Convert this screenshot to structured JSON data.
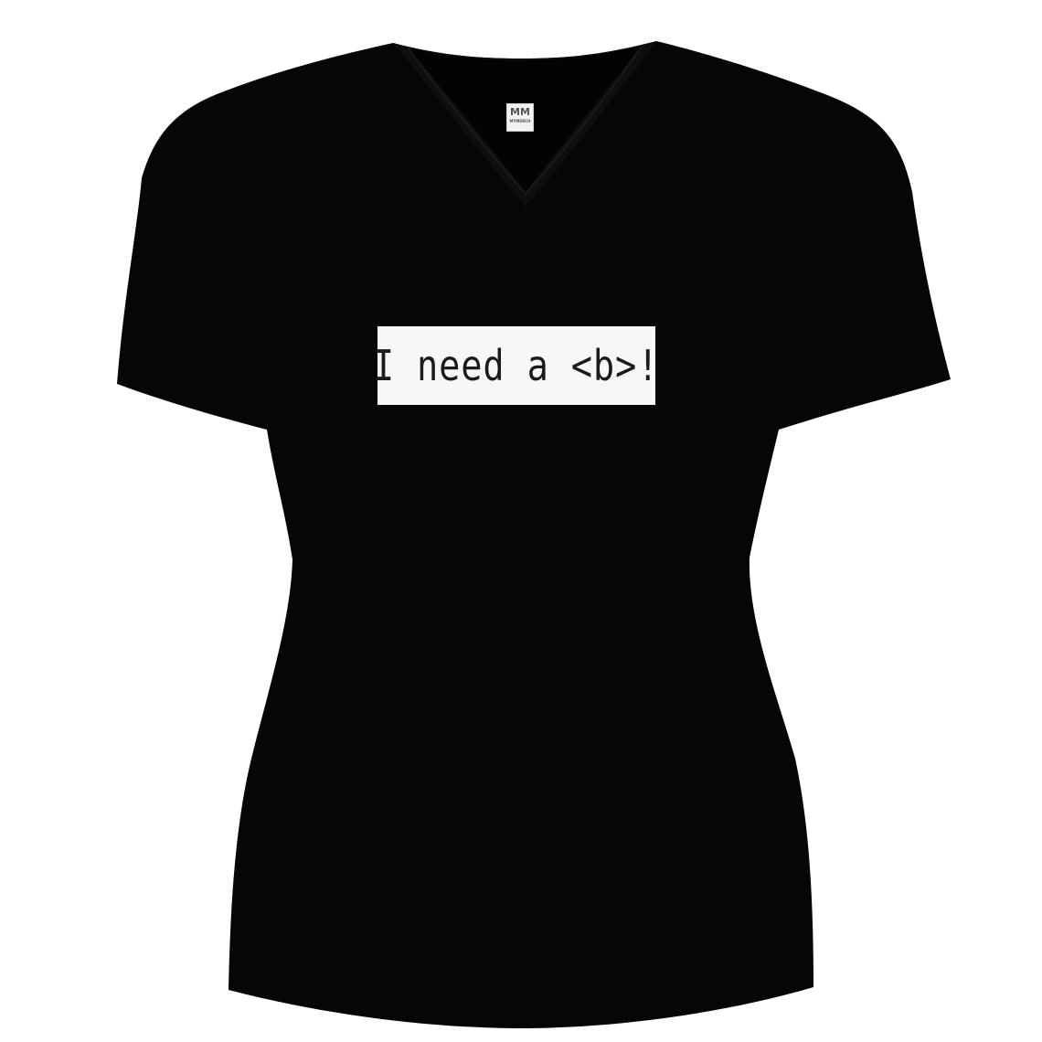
{
  "product": {
    "shirt_color": "#060606",
    "background_color": "#ffffff",
    "print_background_color": "#f7f7f7",
    "print_text_color": "#1b1b1b"
  },
  "neck_tag": {
    "logo": "MM",
    "subtitle": "MYMERCH"
  },
  "print": {
    "text": "I need a <b>!"
  }
}
